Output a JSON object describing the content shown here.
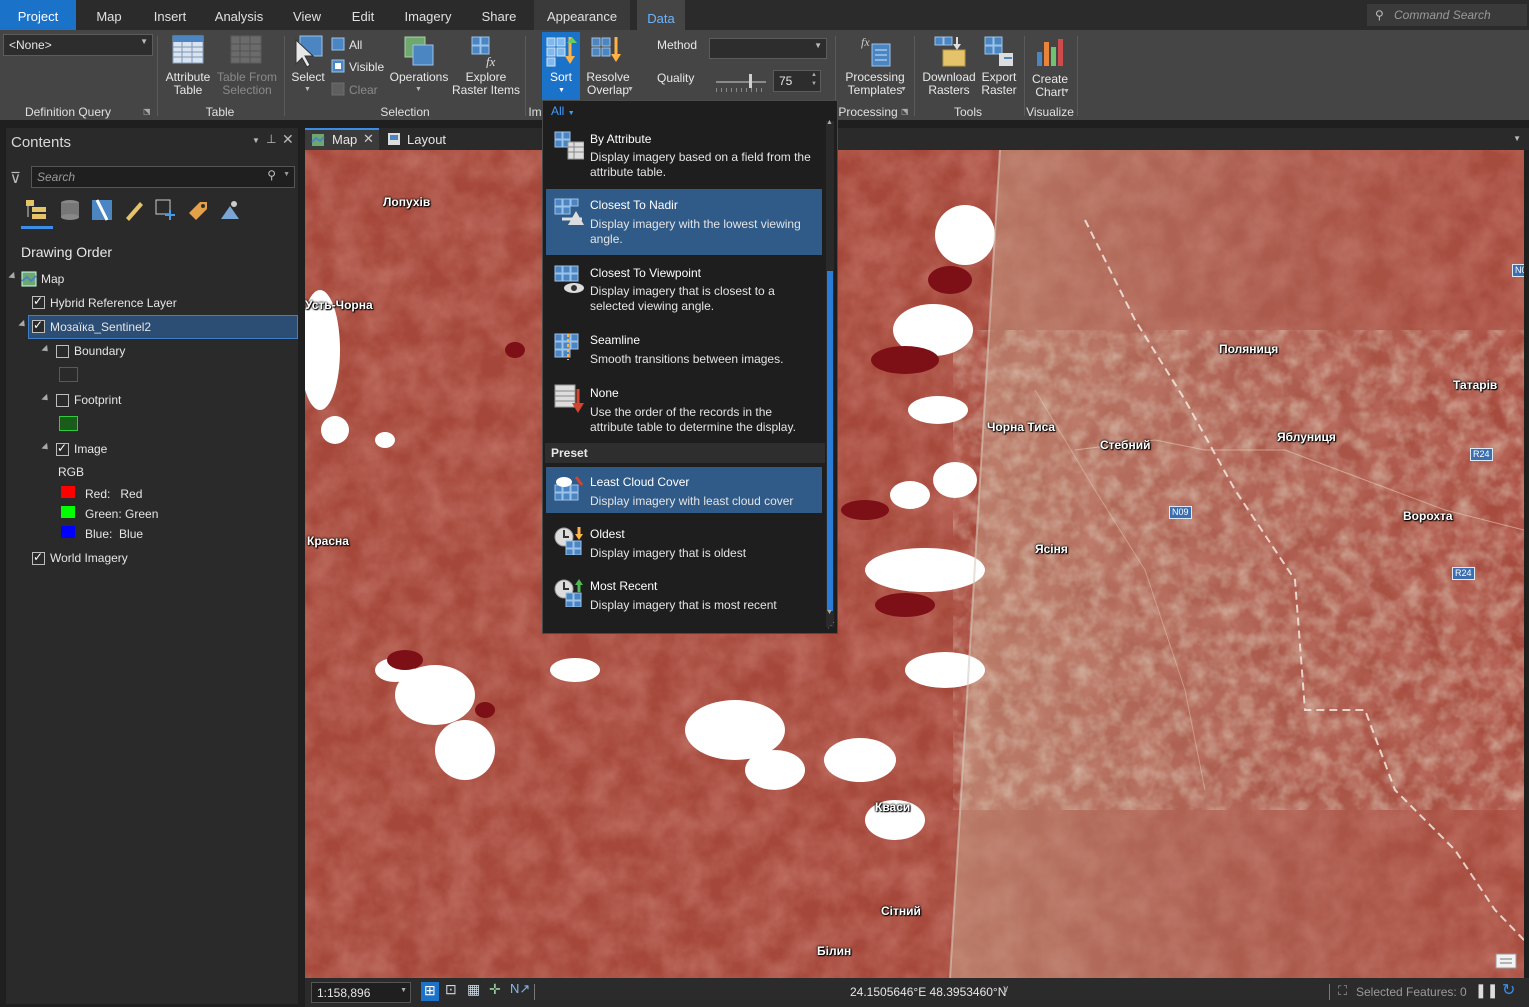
{
  "tabs": [
    "Project",
    "Map",
    "Insert",
    "Analysis",
    "View",
    "Edit",
    "Imagery",
    "Share",
    "Appearance",
    "Data"
  ],
  "command_search_placeholder": "Command Search (Alt+Q)",
  "ribbon": {
    "definition_query_value": "<None>",
    "definition_query_label": "Definition Query",
    "attribute_table": "Attribute\nTable",
    "table_from_selection": "Table From\nSelection",
    "table_group": "Table",
    "select": "Select",
    "sel_all": "All",
    "sel_visible": "Visible",
    "sel_clear": "Clear",
    "operations": "Operations",
    "explore_raster": "Explore\nRaster Items",
    "selection_group": "Selection",
    "sort": "Sort",
    "resolve_overlap": "Resolve\nOverlap",
    "method_label": "Method",
    "quality_label": "Quality",
    "quality_value": "75",
    "im_group_partial": "Im",
    "processing_templates": "Processing\nTemplates",
    "processing_group": "Processing",
    "download_rasters": "Download\nRasters",
    "export_raster": "Export\nRaster",
    "tools_group": "Tools",
    "create_chart": "Create\nChart",
    "visualize_group": "Visualize"
  },
  "contents": {
    "title": "Contents",
    "search_placeholder": "Search",
    "drawing_order": "Drawing Order",
    "map": "Map",
    "hybrid": "Hybrid Reference Layer",
    "mosaic": "Мозаїка_Sentinel2",
    "boundary": "Boundary",
    "footprint": "Footprint",
    "image": "Image",
    "rgb": "RGB",
    "red": "Red:   Red",
    "green": "Green: Green",
    "blue": "Blue:  Blue",
    "world": "World Imagery",
    "colors": {
      "red": "#ff0000",
      "green": "#00ff00",
      "blue": "#0000ff"
    }
  },
  "view_tabs": {
    "map": "Map",
    "layout": "Layout"
  },
  "dropdown": {
    "filter": "All",
    "items": [
      {
        "title": "By Attribute",
        "desc": "Display imagery based on a field from the attribute table."
      },
      {
        "title": "Closest To Nadir",
        "desc": "Display imagery with the lowest viewing angle."
      },
      {
        "title": "Closest To Viewpoint",
        "desc": "Display imagery that is closest to a selected viewing angle."
      },
      {
        "title": "Seamline",
        "desc": "Smooth transitions between images."
      },
      {
        "title": "None",
        "desc": "Use the order of the records in the attribute table to determine the display."
      }
    ],
    "preset_header": "Preset",
    "presets": [
      {
        "title": "Least Cloud Cover",
        "desc": "Display imagery with least cloud cover"
      },
      {
        "title": "Oldest",
        "desc": "Display imagery that is oldest"
      },
      {
        "title": "Most Recent",
        "desc": "Display imagery that is most recent"
      }
    ]
  },
  "places": [
    "Лопухів",
    "Усть-Чорна",
    "Красна",
    "Поляниця",
    "Татарів",
    "Чорна Тиса",
    "Стебний",
    "Яблуниця",
    "Ворохта",
    "Ясіня",
    "Кваси",
    "Сітний",
    "Білин"
  ],
  "shields": [
    "N09",
    "R24",
    "R24",
    "N0"
  ],
  "status": {
    "scale": "1:158,896",
    "coords": "24.1505646°E 48.3953460°N",
    "selected": "Selected Features: 0"
  }
}
